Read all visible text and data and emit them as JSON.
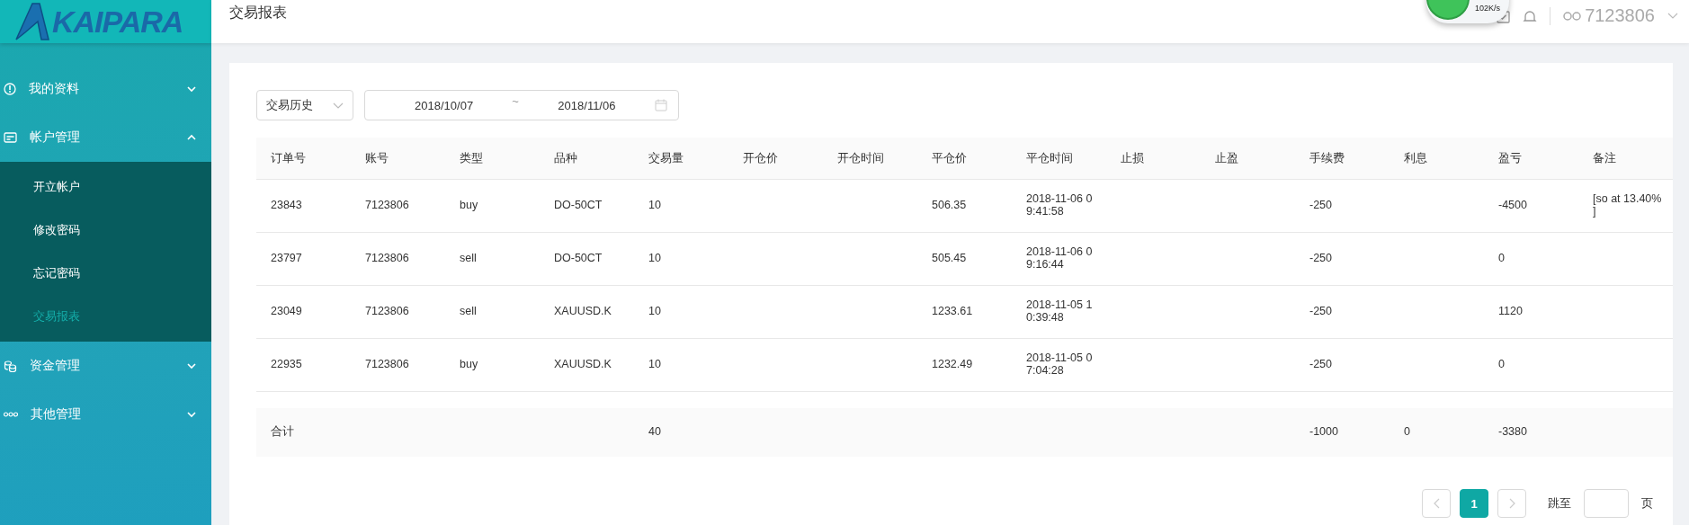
{
  "logo": {
    "text": "KAIPARA"
  },
  "sidebar": {
    "items": [
      {
        "label": "我的资料",
        "expanded": false
      },
      {
        "label": "帐户管理",
        "expanded": true,
        "children": [
          {
            "label": "开立帐户",
            "selected": false
          },
          {
            "label": "修改密码",
            "selected": false
          },
          {
            "label": "忘记密码",
            "selected": false
          },
          {
            "label": "交易报表",
            "selected": true
          }
        ]
      },
      {
        "label": "资金管理",
        "expanded": false
      },
      {
        "label": "其他管理",
        "expanded": false
      }
    ]
  },
  "header": {
    "title": "交易报表",
    "user": "7123806"
  },
  "speed_widget": {
    "reading": "102K/s"
  },
  "filters": {
    "report_type": "交易历史",
    "date_start": "2018/10/07",
    "date_separator": "~",
    "date_end": "2018/11/06"
  },
  "table": {
    "columns": [
      "订单号",
      "账号",
      "类型",
      "品种",
      "交易量",
      "开仓价",
      "开仓时间",
      "平仓价",
      "平仓时间",
      "止损",
      "止盈",
      "手续费",
      "利息",
      "盈亏",
      "备注"
    ],
    "rows": [
      {
        "order_no": "23843",
        "account": "7123806",
        "type": "buy",
        "symbol": "DO-50CT",
        "volume": "10",
        "close_price": "506.35",
        "close_time": "2018-11-06 09:41:58",
        "commission": "-250",
        "profit": "-4500",
        "remark": "[so at 13.40% ]"
      },
      {
        "order_no": "23797",
        "account": "7123806",
        "type": "sell",
        "symbol": "DO-50CT",
        "volume": "10",
        "close_price": "505.45",
        "close_time": "2018-11-06 09:16:44",
        "commission": "-250",
        "profit": "0"
      },
      {
        "order_no": "23049",
        "account": "7123806",
        "type": "sell",
        "symbol": "XAUUSD.K",
        "volume": "10",
        "close_price": "1233.61",
        "close_time": "2018-11-05 10:39:48",
        "commission": "-250",
        "profit": "1120"
      },
      {
        "order_no": "22935",
        "account": "7123806",
        "type": "buy",
        "symbol": "XAUUSD.K",
        "volume": "10",
        "close_price": "1232.49",
        "close_time": "2018-11-05 07:04:28",
        "commission": "-250",
        "profit": "0"
      }
    ],
    "total": {
      "label": "合计",
      "volume": "40",
      "commission": "-1000",
      "interest": "0",
      "profit": "-3380"
    }
  },
  "pagination": {
    "pages": [
      {
        "label": "1",
        "selected": true
      }
    ],
    "jump_label": "跳至",
    "page_suffix": "页"
  }
}
